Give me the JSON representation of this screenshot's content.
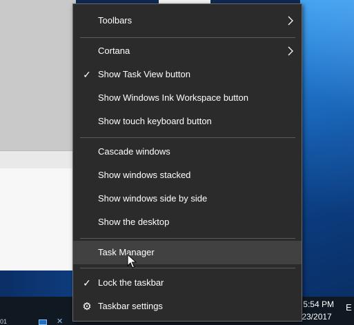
{
  "menu": {
    "items": [
      {
        "label": "Toolbars",
        "submenu": true,
        "checked": false
      },
      {
        "label": "Cortana",
        "submenu": true,
        "checked": false
      },
      {
        "label": "Show Task View button",
        "submenu": false,
        "checked": true
      },
      {
        "label": "Show Windows Ink Workspace button",
        "submenu": false,
        "checked": false
      },
      {
        "label": "Show touch keyboard button",
        "submenu": false,
        "checked": false
      },
      {
        "label": "Cascade windows",
        "submenu": false,
        "checked": false
      },
      {
        "label": "Show windows stacked",
        "submenu": false,
        "checked": false
      },
      {
        "label": "Show windows side by side",
        "submenu": false,
        "checked": false
      },
      {
        "label": "Show the desktop",
        "submenu": false,
        "checked": false
      },
      {
        "label": "Task Manager",
        "submenu": false,
        "checked": false,
        "hovered": true
      },
      {
        "label": "Lock the taskbar",
        "submenu": false,
        "checked": true
      },
      {
        "label": "Taskbar settings",
        "submenu": false,
        "checked": false,
        "icon": "gear-icon"
      }
    ],
    "check_glyph": "✓",
    "gear_glyph": "⚙"
  },
  "taskbar": {
    "time": "5:54 PM",
    "date": "/23/2017",
    "action_center_glyph": "E",
    "left_fragment": "01"
  },
  "colors": {
    "menu_bg": "#2b2b2b",
    "menu_hover": "#414141",
    "separator": "#5c5c5c",
    "taskbar": "#101822"
  }
}
